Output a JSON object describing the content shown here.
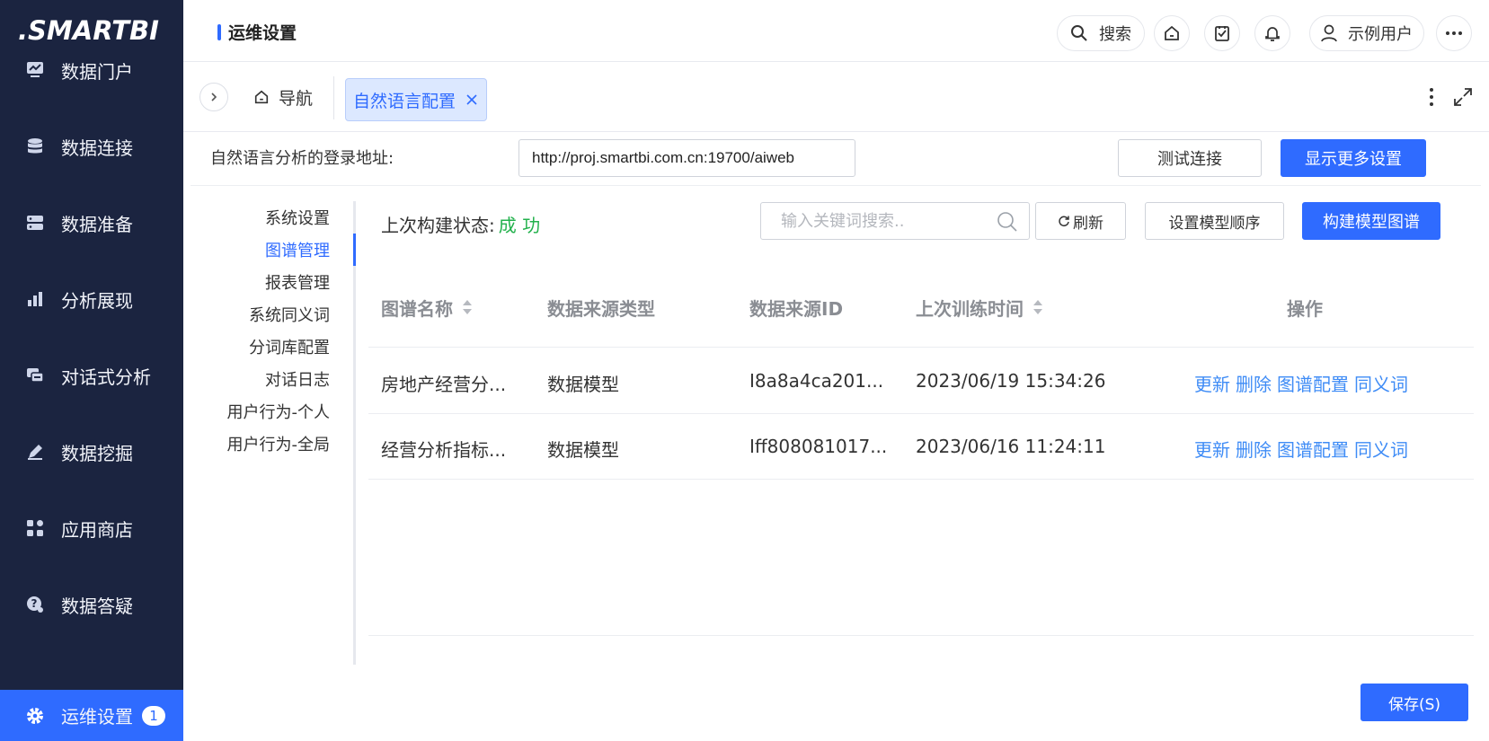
{
  "app": {
    "logo_text": ".SMARTBI"
  },
  "sidebar": {
    "items": [
      {
        "label": "数据门户",
        "icon": "portal-chart-icon"
      },
      {
        "label": "数据连接",
        "icon": "database-icon"
      },
      {
        "label": "数据准备",
        "icon": "server-icon"
      },
      {
        "label": "分析展现",
        "icon": "bar-chart-icon"
      },
      {
        "label": "对话式分析",
        "icon": "chat-icon"
      },
      {
        "label": "数据挖掘",
        "icon": "pen-icon"
      },
      {
        "label": "应用商店",
        "icon": "apps-grid-icon"
      },
      {
        "label": "数据答疑",
        "icon": "question-icon"
      },
      {
        "label": "运维设置",
        "icon": "gear-icon",
        "badge": "1",
        "active": true
      }
    ]
  },
  "header": {
    "title": "运维设置",
    "search_label": "搜索",
    "user_name": "示例用户"
  },
  "tabs": {
    "nav_label": "导航",
    "active_label": "自然语言配置"
  },
  "config": {
    "login_label": "自然语言分析的登录地址:",
    "login_url": "http://proj.smartbi.com.cn:19700/aiweb",
    "test_button": "测试连接",
    "more_button": "显示更多设置"
  },
  "submenu": {
    "items": [
      "系统设置",
      "图谱管理",
      "报表管理",
      "系统同义词",
      "分词库配置",
      "对话日志",
      "用户行为-个人",
      "用户行为-全局"
    ],
    "active_index": 1
  },
  "main": {
    "status_label": "上次构建状态:",
    "status_value": "成 功",
    "search_placeholder": "输入关键词搜索..",
    "refresh_button": "刷新",
    "order_button": "设置模型顺序",
    "build_button": "构建模型图谱",
    "columns": [
      "图谱名称",
      "数据来源类型",
      "数据来源ID",
      "上次训练时间",
      "操作"
    ],
    "rows": [
      {
        "name": "房地产经营分...",
        "type": "数据模型",
        "source_id": "I8a8a4ca201...",
        "time": "2023/06/19 15:34:26"
      },
      {
        "name": "经营分析指标...",
        "type": "数据模型",
        "source_id": "Iff808081017...",
        "time": "2023/06/16 11:24:11"
      }
    ],
    "actions": [
      "更新",
      "删除",
      "图谱配置",
      "同义词"
    ],
    "save_button": "保存(S)"
  },
  "colors": {
    "sidebar_bg": "#1b2440",
    "accent": "#2f6bff",
    "success": "#22b14c",
    "link": "#3f8cf6"
  }
}
